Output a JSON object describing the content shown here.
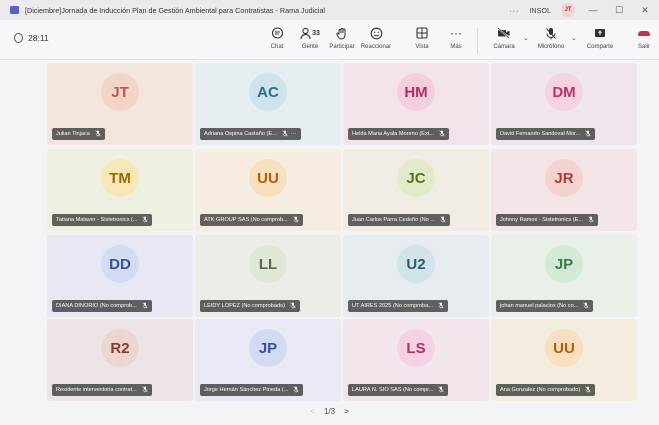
{
  "window": {
    "title": "[Diciembre]Jornada de Inducción Plan de Gestión Ambiental para Contratistas - Rama Judicial",
    "more": "···",
    "org": "INSOL",
    "user_initials": "JT",
    "minimize": "—",
    "maximize": "☐",
    "close": "✕"
  },
  "toolbar": {
    "timer": "28:11",
    "chat": "Chat",
    "people": "Gente",
    "people_count": "33",
    "raise": "Participar",
    "react": "Reaccionar",
    "view": "Vista",
    "more": "Más",
    "more_glyph": "···",
    "camera": "Cámara",
    "mic": "Micrófono",
    "share": "Comparte",
    "leave": "Salir"
  },
  "participants": [
    {
      "initials": "JT",
      "name": "Julian Tinjaca",
      "accent": "#c0534a",
      "bg": "#f5e6dd",
      "avatar_bg": "#f3d4c8"
    },
    {
      "initials": "AC",
      "name": "Adriana Ospina Castaño (E...",
      "accent": "#2a6b8e",
      "bg": "#e7eef2",
      "avatar_bg": "#cfe3ec",
      "more": "···"
    },
    {
      "initials": "HM",
      "name": "Helda Maria Ayala Moreno (Ext...",
      "accent": "#b0306a",
      "bg": "#f3e3ea",
      "avatar_bg": "#f1cfdc"
    },
    {
      "initials": "DM",
      "name": "David Fernando Sandoval Mor...",
      "accent": "#c0306a",
      "bg": "#efe5ee",
      "avatar_bg": "#f4d2e0"
    },
    {
      "initials": "TM",
      "name": "Tatiana Malaver - Sistetronics (...",
      "accent": "#9a6b00",
      "bg": "#eef0e2",
      "avatar_bg": "#f7e6b6"
    },
    {
      "initials": "UU",
      "name": "ATK GROUP SAS (No comprob...",
      "accent": "#b85b00",
      "bg": "#f7ede2",
      "avatar_bg": "#f8dfc0"
    },
    {
      "initials": "JC",
      "name": "Juan Carlos Parra Cedeño (No ...",
      "accent": "#56721c",
      "bg": "#f1ece4",
      "avatar_bg": "#e2ebc9"
    },
    {
      "initials": "JR",
      "name": "Johnny Ramos - Sistetronics (E...",
      "accent": "#b53a35",
      "bg": "#f4e6e6",
      "avatar_bg": "#f4d2cf"
    },
    {
      "initials": "DD",
      "name": "DIANA DINORIO (No comprob...",
      "accent": "#3a4e9e",
      "bg": "#e6e8f3",
      "avatar_bg": "#d3dbf3"
    },
    {
      "initials": "LL",
      "name": "LEIDY LOPEZ (No comprobado)",
      "accent": "#5d6b4b",
      "bg": "#eaeee7",
      "avatar_bg": "#dfe7d6"
    },
    {
      "initials": "U2",
      "name": "UT AIRES 2025 (No comproba...",
      "accent": "#2d5a72",
      "bg": "#e6ecef",
      "avatar_bg": "#d2e3ea"
    },
    {
      "initials": "JP",
      "name": "johan manuel palacios (No co...",
      "accent": "#3d7a4a",
      "bg": "#e8f0e8",
      "avatar_bg": "#d3e9d6"
    },
    {
      "initials": "R2",
      "name": "Residente interventoria contrat...",
      "accent": "#8a3a2a",
      "bg": "#ede4e8",
      "avatar_bg": "#ecd6d0"
    },
    {
      "initials": "JP",
      "name": "Jorge Hernán Sánchez Pineda (...",
      "accent": "#3a4e9e",
      "bg": "#e8eaf4",
      "avatar_bg": "#d3dbf3"
    },
    {
      "initials": "LS",
      "name": "LAURA N. SIO SAS (No compr...",
      "accent": "#b0306a",
      "bg": "#f2e6ee",
      "avatar_bg": "#f5d2e2"
    },
    {
      "initials": "UU",
      "name": "Ana Gonzalez (No comprobado)",
      "accent": "#b85b00",
      "bg": "#f2eddf",
      "avatar_bg": "#f8dfc0"
    }
  ],
  "pager": {
    "prev": "<",
    "label": "1/3",
    "next": ">"
  }
}
